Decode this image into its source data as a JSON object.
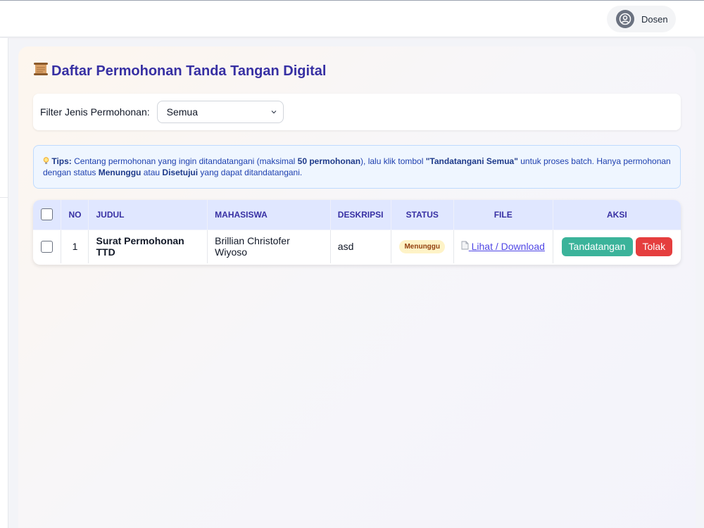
{
  "header": {
    "user_name": "Dosen",
    "user_icon": "user-circle-icon"
  },
  "page": {
    "title_icon": "scroll-icon",
    "title": "Daftar Permohonan Tanda Tangan Digital"
  },
  "filter": {
    "label": "Filter Jenis Permohonan:",
    "selected": "Semua"
  },
  "tips": {
    "icon": "lightbulb-icon",
    "label": "Tips:",
    "t1": " Centang permohonan yang ingin ditandatangani (maksimal ",
    "b1": "50 permohonan",
    "t2": "), lalu klik tombol ",
    "b2": "\"Tandatangani Semua\"",
    "t3": " untuk proses batch. Hanya permohonan dengan status ",
    "b3": "Menunggu",
    "t4": " atau ",
    "b4": "Disetujui",
    "t5": " yang dapat ditandatangani."
  },
  "table": {
    "headers": {
      "no": "NO",
      "judul": "JUDUL",
      "mahasiswa": "MAHASISWA",
      "deskripsi": "DESKRIPSI",
      "status": "STATUS",
      "file": "FILE",
      "aksi": "AKSI"
    },
    "rows": [
      {
        "no": "1",
        "judul": "Surat Permohonan TTD",
        "mahasiswa": "Brillian Christofer Wiyoso",
        "deskripsi": "asd",
        "status": "Menunggu",
        "file_icon": "document-icon",
        "file_label": "Lihat / Download",
        "action_sign": "Tandatangan",
        "action_reject": "Tolak"
      }
    ]
  },
  "colors": {
    "accent": "#3730a3",
    "sign_button": "#3bb39a",
    "reject_button": "#e53e3e",
    "status_pending_bg": "#fef3c7"
  }
}
